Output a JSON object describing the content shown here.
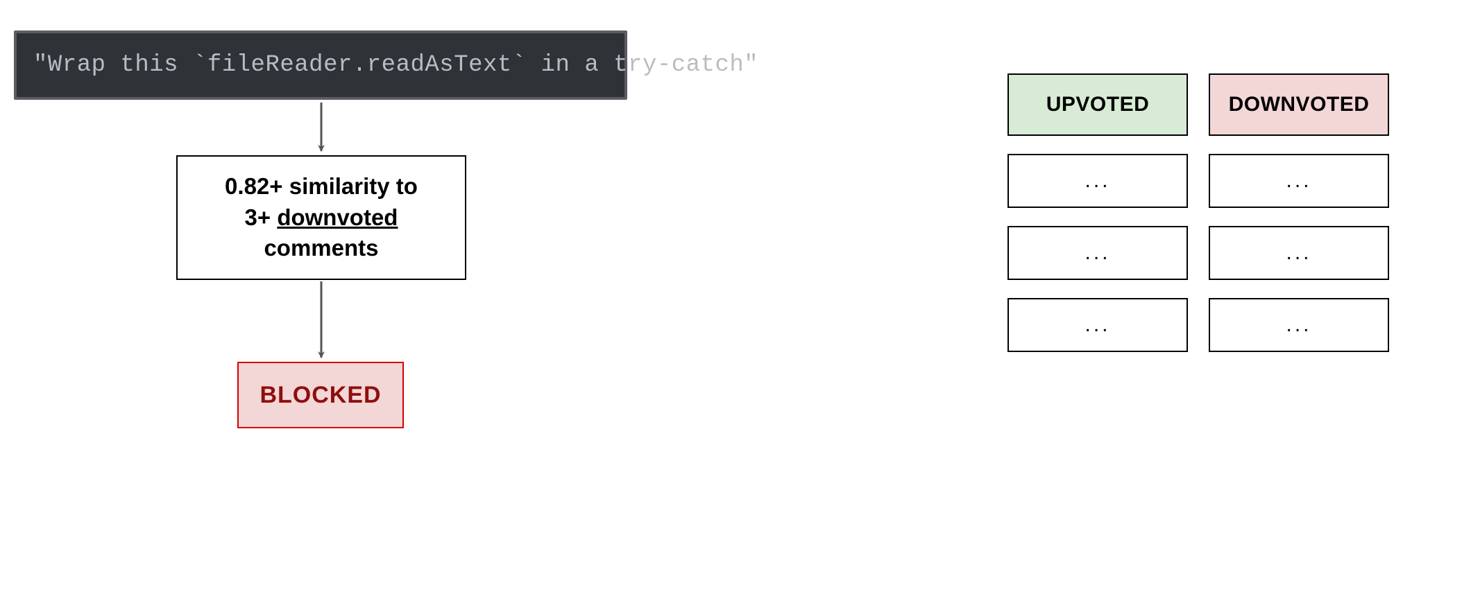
{
  "code_snippet": "\"Wrap this `fileReader.readAsText` in a try-catch\"",
  "rule": {
    "line1": "0.82+ similarity to",
    "line2_pre": "3+ ",
    "line2_underlined": "downvoted",
    "line3": "comments"
  },
  "blocked_label": "BLOCKED",
  "columns": {
    "upvoted": {
      "header": "UPVOTED",
      "rows": [
        "...",
        "...",
        "..."
      ]
    },
    "downvoted": {
      "header": "DOWNVOTED",
      "rows": [
        "...",
        "...",
        "..."
      ]
    }
  },
  "colors": {
    "code_bg": "#2f3338",
    "code_border": "#5a5e63",
    "code_text": "#b9bdc3",
    "blocked_bg": "#f3d6d6",
    "blocked_border": "#d60000",
    "blocked_text": "#8f0e0e",
    "upvoted_bg": "#d8ecd5",
    "downvoted_bg": "#f3d6d6",
    "arrow": "#555555"
  }
}
